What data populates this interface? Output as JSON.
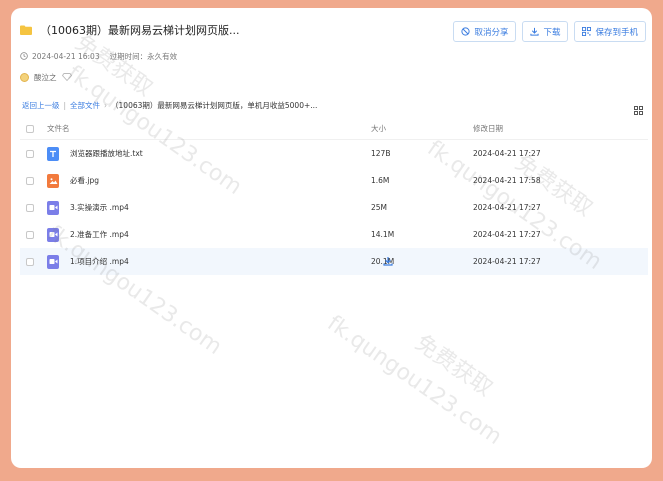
{
  "header": {
    "title": "（10063期）最新网易云梯计划网页版...",
    "actions": [
      {
        "label": "取消分享",
        "icon": "cancel-share-icon"
      },
      {
        "label": "下载",
        "icon": "download-icon"
      },
      {
        "label": "保存到手机",
        "icon": "qr-code-icon"
      }
    ]
  },
  "meta": {
    "created": "2024-04-21 16:03",
    "expiry": "过期时间：永久有效"
  },
  "sharer": {
    "name": "酸泣之"
  },
  "breadcrumb": {
    "back": "返回上一级",
    "root": "全部文件",
    "current": "（10063期）最新网易云梯计划网页版，单机月收益5000+..."
  },
  "table": {
    "headers": {
      "name": "文件名",
      "size": "大小",
      "date": "修改日期"
    },
    "rows": [
      {
        "name": "浏览器跟播放地址.txt",
        "size": "127B",
        "date": "2024-04-21 17:27",
        "icon": "txt-file-icon",
        "color": "#4c8df6"
      },
      {
        "name": "必看.jpg",
        "size": "1.6M",
        "date": "2024-04-21 17:58",
        "icon": "image-file-icon",
        "color": "#f27a3d"
      },
      {
        "name": "3.实操演示 .mp4",
        "size": "25M",
        "date": "2024-04-21 17:27",
        "icon": "video-file-icon",
        "color": "#7b7ee8"
      },
      {
        "name": "2.准备工作 .mp4",
        "size": "14.1M",
        "date": "2024-04-21 17:27",
        "icon": "video-file-icon",
        "color": "#7b7ee8"
      },
      {
        "name": "1.项目介绍 .mp4",
        "size": "20.1M",
        "date": "2024-04-21 17:27",
        "icon": "video-file-icon",
        "color": "#7b7ee8"
      }
    ]
  },
  "watermark": {
    "text1": "免费获取",
    "text2": "fk.qungou123.com"
  },
  "colors": {
    "accent": "#3b7de0",
    "background": "#f0a98c"
  }
}
